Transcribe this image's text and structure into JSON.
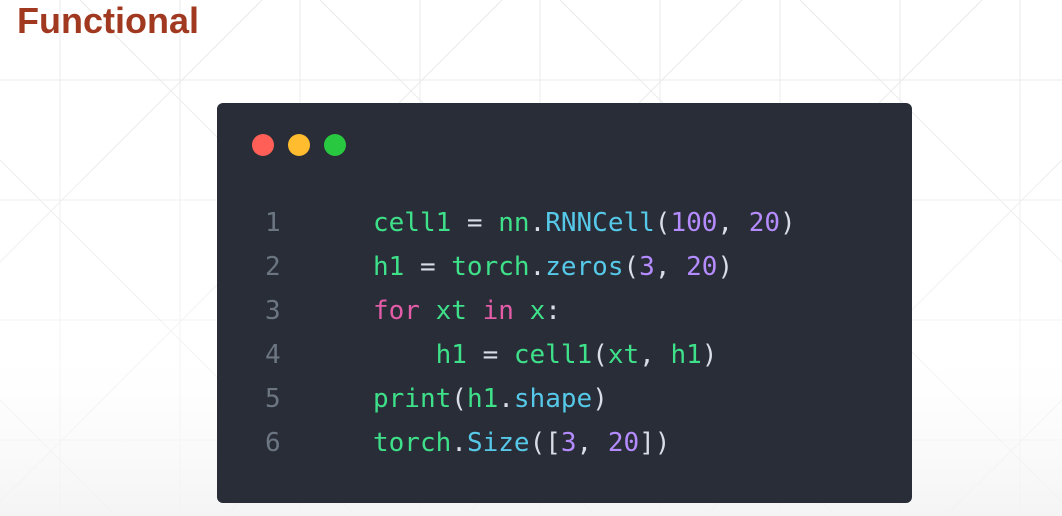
{
  "slide": {
    "title": "Functional"
  },
  "window": {
    "background": "#292d37",
    "traffic_lights": [
      {
        "name": "close",
        "color": "#ff5f57"
      },
      {
        "name": "minimize",
        "color": "#febc2e"
      },
      {
        "name": "maximize",
        "color": "#28c840"
      }
    ]
  },
  "syntax_colors": {
    "plain": "#d8dde6",
    "name": "#3ee08a",
    "module": "#3ee08a",
    "attr": "#56c8e8",
    "number": "#b58cff",
    "keyword": "#e25ca7",
    "punct": "#d8dde6",
    "line_number": "#6c7683"
  },
  "code": {
    "lines": [
      {
        "number": "1",
        "tokens": [
          {
            "t": "cell1",
            "k": "name"
          },
          {
            "t": " = ",
            "k": "plain"
          },
          {
            "t": "nn",
            "k": "module"
          },
          {
            "t": ".",
            "k": "punct"
          },
          {
            "t": "RNNCell",
            "k": "attr"
          },
          {
            "t": "(",
            "k": "punct"
          },
          {
            "t": "100",
            "k": "number"
          },
          {
            "t": ", ",
            "k": "punct"
          },
          {
            "t": "20",
            "k": "number"
          },
          {
            "t": ")",
            "k": "punct"
          }
        ]
      },
      {
        "number": "2",
        "tokens": [
          {
            "t": "h1",
            "k": "name"
          },
          {
            "t": " = ",
            "k": "plain"
          },
          {
            "t": "torch",
            "k": "module"
          },
          {
            "t": ".",
            "k": "punct"
          },
          {
            "t": "zeros",
            "k": "attr"
          },
          {
            "t": "(",
            "k": "punct"
          },
          {
            "t": "3",
            "k": "number"
          },
          {
            "t": ", ",
            "k": "punct"
          },
          {
            "t": "20",
            "k": "number"
          },
          {
            "t": ")",
            "k": "punct"
          }
        ]
      },
      {
        "number": "3",
        "tokens": [
          {
            "t": "for",
            "k": "keyword"
          },
          {
            "t": " ",
            "k": "plain"
          },
          {
            "t": "xt",
            "k": "name"
          },
          {
            "t": " ",
            "k": "plain"
          },
          {
            "t": "in",
            "k": "keyword"
          },
          {
            "t": " ",
            "k": "plain"
          },
          {
            "t": "x",
            "k": "name"
          },
          {
            "t": ":",
            "k": "punct"
          }
        ]
      },
      {
        "number": "4",
        "tokens": [
          {
            "t": "    ",
            "k": "plain"
          },
          {
            "t": "h1",
            "k": "name"
          },
          {
            "t": " = ",
            "k": "plain"
          },
          {
            "t": "cell1",
            "k": "name"
          },
          {
            "t": "(",
            "k": "punct"
          },
          {
            "t": "xt",
            "k": "name"
          },
          {
            "t": ", ",
            "k": "punct"
          },
          {
            "t": "h1",
            "k": "name"
          },
          {
            "t": ")",
            "k": "punct"
          }
        ]
      },
      {
        "number": "5",
        "tokens": [
          {
            "t": "print",
            "k": "name"
          },
          {
            "t": "(",
            "k": "punct"
          },
          {
            "t": "h1",
            "k": "name"
          },
          {
            "t": ".",
            "k": "punct"
          },
          {
            "t": "shape",
            "k": "attr"
          },
          {
            "t": ")",
            "k": "punct"
          }
        ]
      },
      {
        "number": "6",
        "tokens": [
          {
            "t": "torch",
            "k": "module"
          },
          {
            "t": ".",
            "k": "punct"
          },
          {
            "t": "Size",
            "k": "attr"
          },
          {
            "t": "([",
            "k": "punct"
          },
          {
            "t": "3",
            "k": "number"
          },
          {
            "t": ", ",
            "k": "punct"
          },
          {
            "t": "20",
            "k": "number"
          },
          {
            "t": "])",
            "k": "punct"
          }
        ]
      }
    ]
  }
}
